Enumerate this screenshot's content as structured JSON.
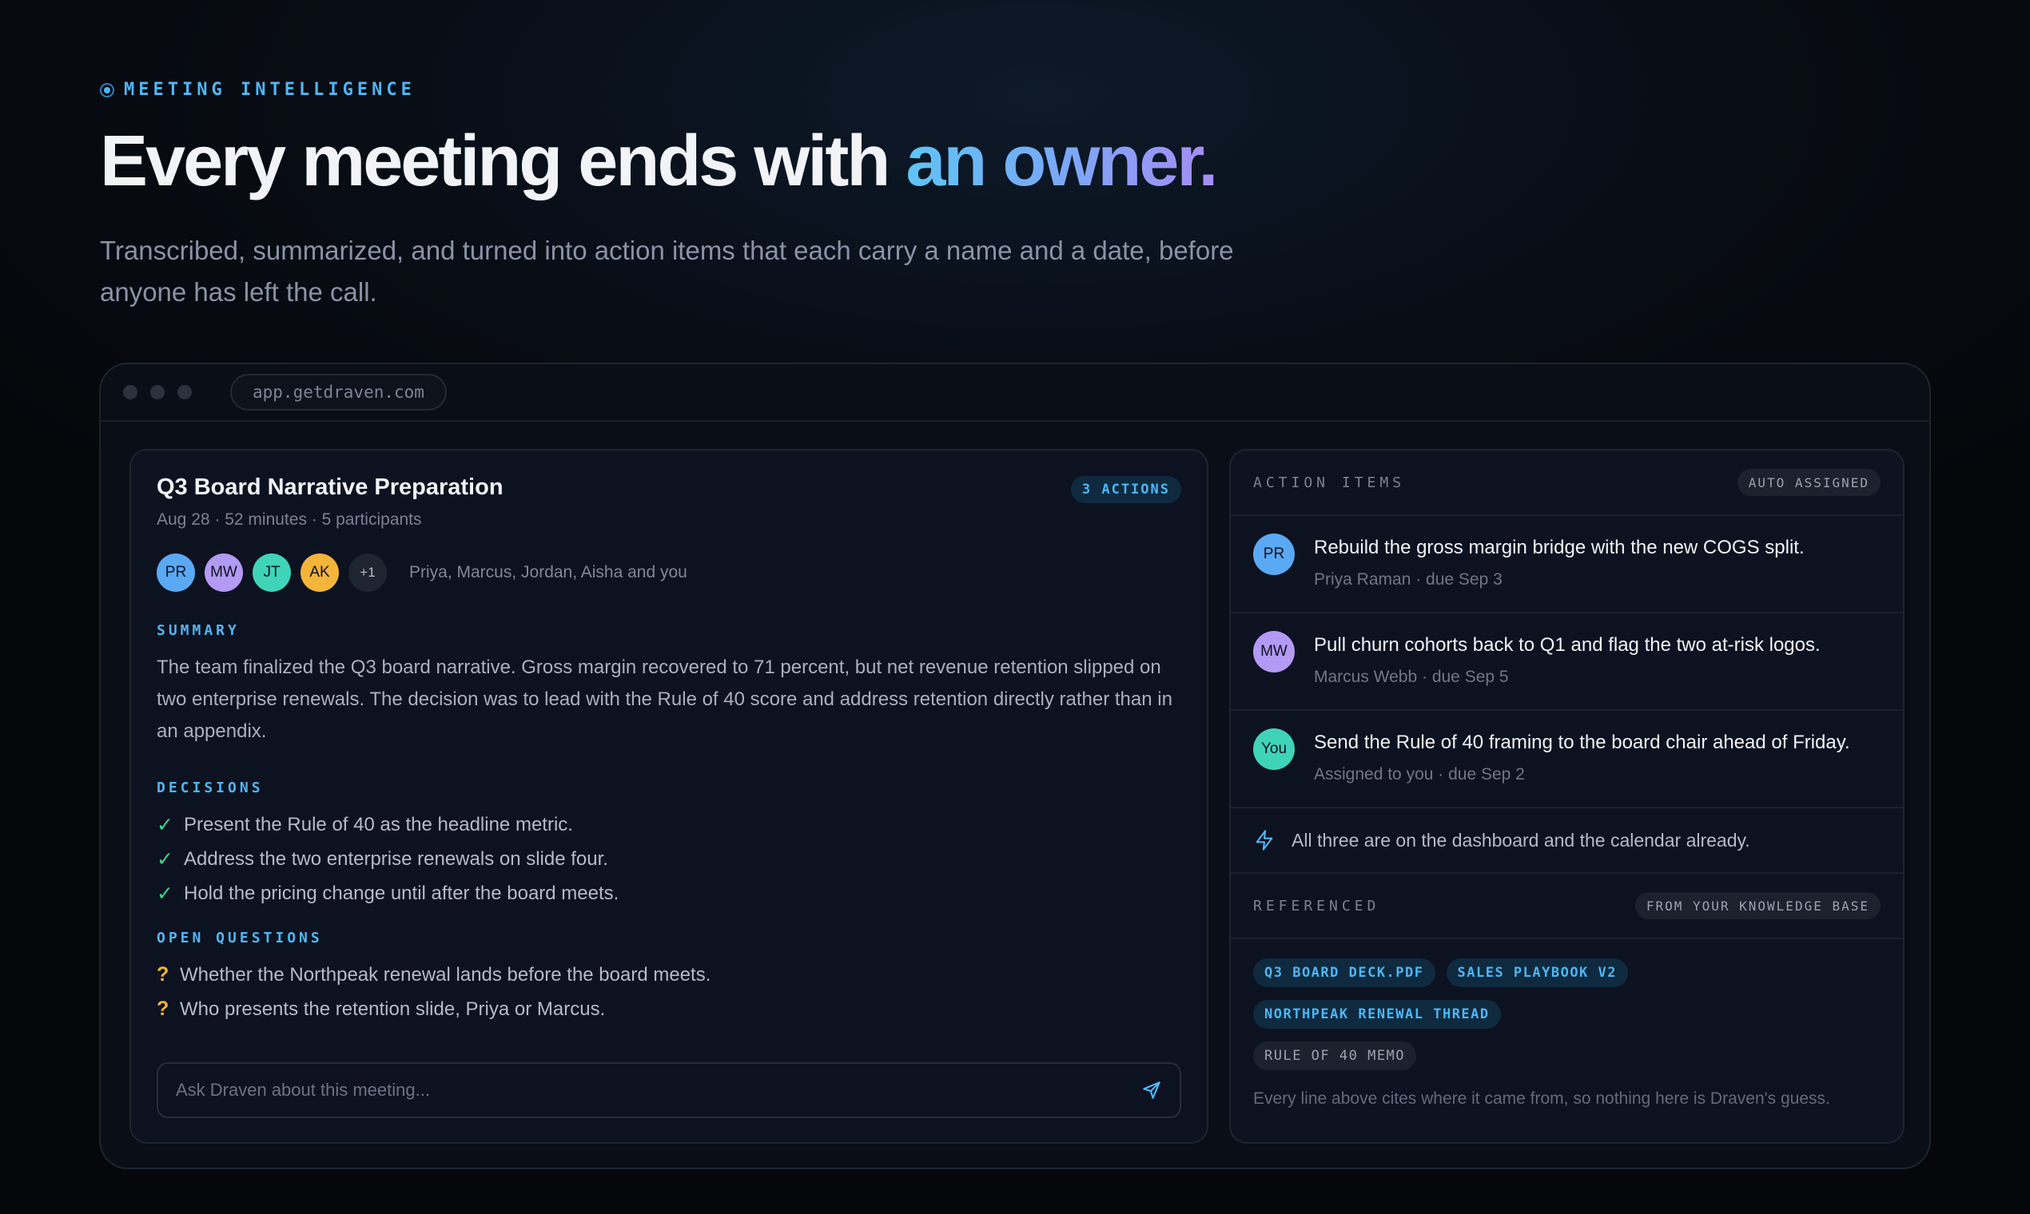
{
  "hero": {
    "eyebrow": "MEETING INTELLIGENCE",
    "headline_main": "Every meeting ends with ",
    "headline_accent": "an owner.",
    "subtitle": "Transcribed, summarized, and turned into action items that each carry a name and a date, before anyone has left the call."
  },
  "browser": {
    "url": "app.getdraven.com"
  },
  "meeting": {
    "title": "Q3 Board Narrative Preparation",
    "actions_badge": "3 ACTIONS",
    "meta": "Aug 28 · 52 minutes · 5 participants",
    "avatars": [
      {
        "initials": "PR",
        "color": "#5aa9f5"
      },
      {
        "initials": "MW",
        "color": "#b39af5"
      },
      {
        "initials": "JT",
        "color": "#3fd4b9"
      },
      {
        "initials": "AK",
        "color": "#f5b43a"
      },
      {
        "initials": "+1",
        "color": "#1e2430"
      }
    ],
    "participants": "Priya, Marcus, Jordan, Aisha and you",
    "summary_heading": "SUMMARY",
    "summary": "The team finalized the Q3 board narrative. Gross margin recovered to 71 percent, but net revenue retention slipped on two enterprise renewals. The decision was to lead with the Rule of 40 score and address retention directly rather than in an appendix.",
    "decisions_heading": "DECISIONS",
    "decisions": [
      "Present the Rule of 40 as the headline metric.",
      "Address the two enterprise renewals on slide four.",
      "Hold the pricing change until after the board meets."
    ],
    "questions_heading": "OPEN QUESTIONS",
    "questions": [
      "Whether the Northpeak renewal lands before the board meets.",
      "Who presents the retention slide, Priya or Marcus."
    ],
    "ask_placeholder": "Ask Draven about this meeting..."
  },
  "action_items": {
    "heading": "ACTION ITEMS",
    "badge": "AUTO ASSIGNED",
    "items": [
      {
        "initials": "PR",
        "color": "#5aa9f5",
        "title": "Rebuild the gross margin bridge with the new COGS split.",
        "sub": "Priya Raman · due Sep 3"
      },
      {
        "initials": "MW",
        "color": "#b39af5",
        "title": "Pull churn cohorts back to Q1 and flag the two at-risk logos.",
        "sub": "Marcus Webb · due Sep 5"
      },
      {
        "initials": "You",
        "color": "#3fd4b9",
        "title": "Send the Rule of 40 framing to the board chair ahead of Friday.",
        "sub": "Assigned to you · due Sep 2"
      }
    ],
    "note": "All three are on the dashboard and the calendar already."
  },
  "referenced": {
    "heading": "REFERENCED",
    "badge": "FROM YOUR KNOWLEDGE BASE",
    "tags": [
      {
        "label": "Q3 BOARD DECK.PDF",
        "style": "blue"
      },
      {
        "label": "SALES PLAYBOOK V2",
        "style": "blue"
      },
      {
        "label": "NORTHPEAK RENEWAL THREAD",
        "style": "blue"
      },
      {
        "label": "RULE OF 40 MEMO",
        "style": "grey"
      }
    ],
    "citation_note": "Every line above cites where it came from, so nothing here is Draven's guess."
  }
}
